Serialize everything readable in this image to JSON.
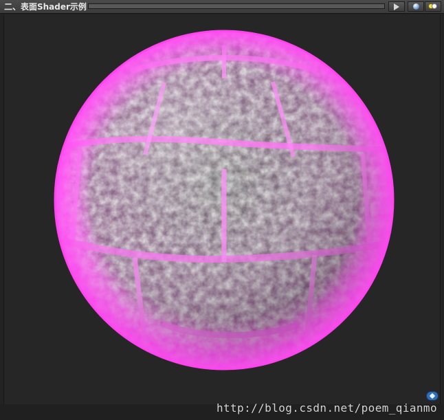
{
  "window": {
    "title": "二、表面Shader示例"
  },
  "toolbar": {
    "play_icon": "play-icon",
    "sphere_icon": "sphere-icon",
    "lights_icon": "lights-icon"
  },
  "preview": {
    "object": "sphere",
    "material_tint": "#f078f0",
    "background": "#262626"
  },
  "footer": {
    "watermark": "http://blog.csdn.net/poem_qianmo",
    "badge_icon": "tag-icon"
  }
}
